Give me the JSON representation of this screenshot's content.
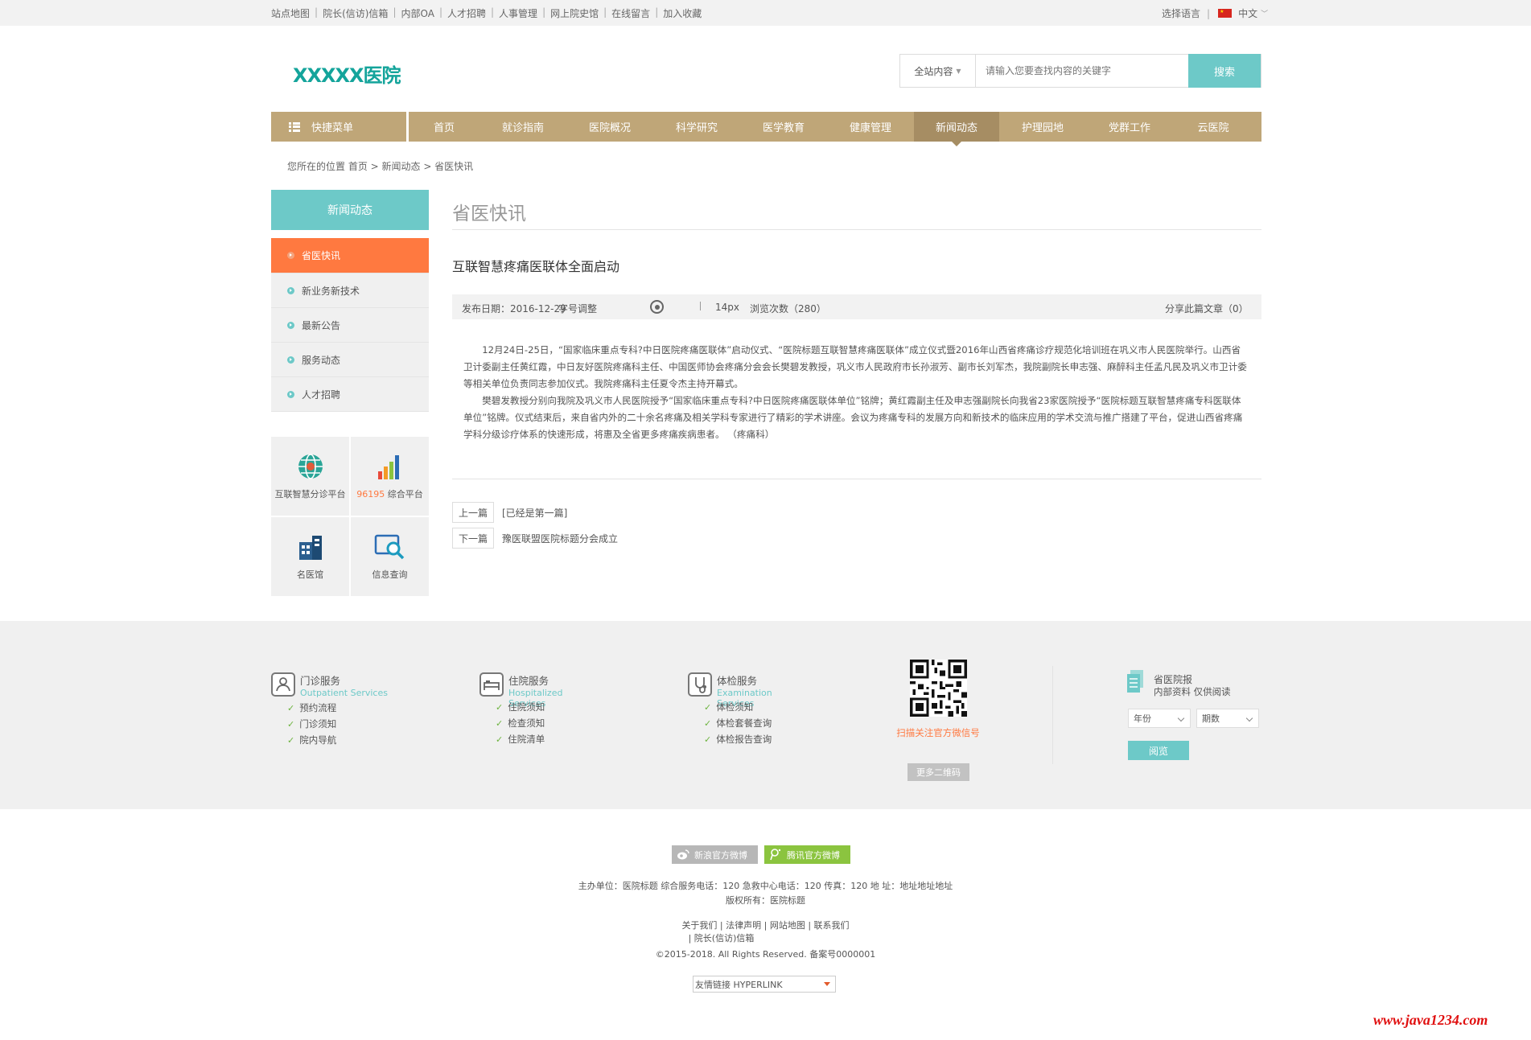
{
  "topbar": {
    "links": [
      "站点地图",
      "院长(信访)信箱",
      "内部OA",
      "人才招聘",
      "人事管理",
      "网上院史馆",
      "在线留言",
      "加入收藏"
    ],
    "language_label": "选择语言",
    "language_value": "中文"
  },
  "header": {
    "logo": "XXXXX医院",
    "search_scope": "全站内容",
    "search_placeholder": "请输入您要查找内容的关键字",
    "search_button": "搜索"
  },
  "nav": {
    "quick_menu": "快捷菜单",
    "items": [
      "首页",
      "就诊指南",
      "医院概况",
      "科学研究",
      "医学教育",
      "健康管理",
      "新闻动态",
      "护理园地",
      "党群工作",
      "云医院"
    ],
    "active_index": 6
  },
  "breadcrumb": "您所在的位置 首页 > 新闻动态 > 省医快讯",
  "sidebar": {
    "heading": "新闻动态",
    "items": [
      "省医快讯",
      "新业务新技术",
      "最新公告",
      "服务动态",
      "人才招聘"
    ],
    "active_index": 0,
    "tiles": [
      {
        "label": "互联智慧分诊平台",
        "icon": "globe-icon"
      },
      {
        "label_prefix": "96195",
        "label": "综合平台",
        "icon": "bar-chart-icon"
      },
      {
        "label": "名医馆",
        "icon": "building-icon"
      },
      {
        "label": "信息查询",
        "icon": "magnifier-icon"
      }
    ]
  },
  "article": {
    "section_title": "省医快讯",
    "title": "互联智慧疼痛医联体全面启动",
    "publish_date": "发布日期：2016-12-29",
    "font_adjust": "字号调整",
    "font_size": "14px",
    "views": "浏览次数（280）",
    "share": "分享此篇文章（0）",
    "paragraphs": [
      "12月24日-25日，“国家临床重点专科?中日医院疼痛医联体”启动仪式、“医院标题互联智慧疼痛医联体”成立仪式暨2016年山西省疼痛诊疗规范化培训班在巩义市人民医院举行。山西省卫计委副主任黄红霞，中日友好医院疼痛科主任、中国医师协会疼痛分会会长樊碧发教授，巩义市人民政府市长孙淑芳、副市长刘军杰，我院副院长申志强、麻醉科主任孟凡民及巩义市卫计委等相关单位负责同志参加仪式。我院疼痛科主任夏令杰主持开幕式。",
      "樊碧发教授分别向我院及巩义市人民医院授予“国家临床重点专科?中日医院疼痛医联体单位”铭牌；黄红霞副主任及申志强副院长向我省23家医院授予“医院标题互联智慧疼痛专科医联体单位”铭牌。仪式结束后，来自省内外的二十余名疼痛及相关学科专家进行了精彩的学术讲座。会议为疼痛专科的发展方向和新技术的临床应用的学术交流与推广搭建了平台，促进山西省疼痛学科分级诊疗体系的快速形成，将惠及全省更多疼痛疾病患者。          （疼痛科）"
    ],
    "prev_label": "上一篇",
    "prev_value": "[已经是第一篇]",
    "next_label": "下一篇",
    "next_value": "豫医联盟医院标题分会成立"
  },
  "services": [
    {
      "title": "门诊服务",
      "en": "Outpatient Services",
      "items": [
        "预约流程",
        "门诊须知",
        "院内导航"
      ],
      "icon": "outpatient-icon"
    },
    {
      "title": "住院服务",
      "en": "Hospitalized Services",
      "items": [
        "住院须知",
        "检查须知",
        "住院清单"
      ],
      "icon": "bed-icon"
    },
    {
      "title": "体检服务",
      "en": "Examination Services",
      "items": [
        "体检须知",
        "体检套餐查询",
        "体检报告查询"
      ],
      "icon": "stethoscope-icon"
    }
  ],
  "qr": {
    "caption": "扫描关注官方微信号",
    "more_button": "更多二维码"
  },
  "paper": {
    "title": "省医院报",
    "subtitle": "内部资料 仅供阅读",
    "year_select": "年份",
    "issue_select": "期数",
    "read_button": "阅览"
  },
  "footer": {
    "sina_weibo": "新浪官方微博",
    "tencent_weibo": "腾讯官方微博",
    "info_line": "主办单位：医院标题  综合服务电话：120  急救中心电话：120  传真：120  地 址：地址地址地址",
    "copyright_owner": "版权所有：医院标题",
    "links_line": "关于我们 | 法律声明 | 网站地图 | 联系我们",
    "links_line2": "| 院长(信访)信箱",
    "copyright": "©2015-2018. All Rights Reserved. 备案号0000001",
    "friend_link": "友情链接 HYPERLINK"
  },
  "watermark": "www.java1234.com",
  "colors": {
    "accent_teal": "#6dc9c8",
    "nav_gold": "#bfa678",
    "active_orange": "#ff7940",
    "logo_green": "#14a49b"
  }
}
